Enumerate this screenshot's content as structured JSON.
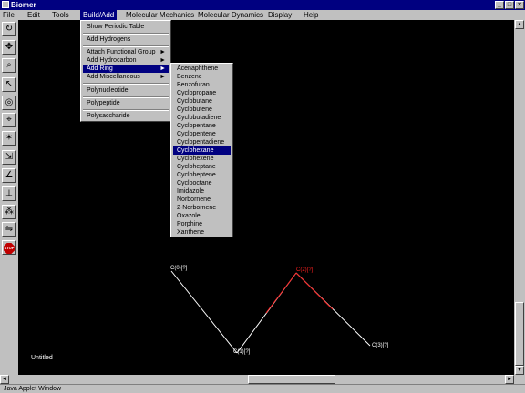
{
  "window": {
    "title": "Biomer"
  },
  "window_buttons": {
    "minimize": "_",
    "maximize": "□",
    "close": "×"
  },
  "menubar": [
    "File",
    "Edit",
    "Tools",
    "Build/Add",
    "Molecular Mechanics",
    "Molecular Dynamics",
    "Display",
    "Help"
  ],
  "active_menu": "Build/Add",
  "build_menu": {
    "show_periodic_table": "Show Periodic Table",
    "add_hydrogens": "Add Hydrogens",
    "attach_functional_group": "Attach Functional Group",
    "add_hydrocarbon": "Add Hydrocarbon",
    "add_ring": "Add Ring",
    "add_miscellaneous": "Add Miscellaneous",
    "polynucleotide": "Polynucleotide",
    "polypeptide": "Polypeptide",
    "polysaccharide": "Polysaccharide",
    "arrow": "►"
  },
  "ring_submenu": [
    "Acenaphthene",
    "Benzene",
    "Benzofuran",
    "Cyclopropane",
    "Cyclobutane",
    "Cyclobutene",
    "Cyclobutadiene",
    "Cyclopentane",
    "Cyclopentene",
    "Cyclopentadiene",
    "Cyclohexane",
    "Cyclohexene",
    "Cycloheptane",
    "Cycloheptene",
    "Cyclooctane",
    "Imidazole",
    "Norbornene",
    "2-Norbornene",
    "Oxazole",
    "Porphine",
    "Xanthene"
  ],
  "selected_ring": "Cyclohexane",
  "toolbar_icons": [
    "rotate-icon",
    "translate-icon",
    "zoom-icon",
    "select-arrow-icon",
    "lasso-icon",
    "select-atom-icon",
    "select-molecule-icon",
    "bond-length-icon",
    "bond-angle-icon",
    "dihedral-icon",
    "add-atom-icon",
    "add-bond-icon",
    "stop-icon"
  ],
  "toolbar_glyphs": [
    "↻",
    "✥",
    "⌕",
    "↖",
    "◎",
    "⌖",
    "✶",
    "⇲",
    "∠",
    "⟂",
    "⁂",
    "⇋",
    "STOP"
  ],
  "molecule": {
    "atoms": [
      {
        "label": "C(0)[?]",
        "color": "#ffffff"
      },
      {
        "label": "C(1)[?]",
        "color": "#ffffff"
      },
      {
        "label": "C(2)[?]",
        "color": "#ff2020"
      },
      {
        "label": "C(3)[?]",
        "color": "#ffffff"
      }
    ],
    "bond_colors": {
      "normal": "#ffffff",
      "selected": "#ff2020"
    }
  },
  "canvas_label": "Untitled",
  "scroll_arrows": {
    "up": "▲",
    "down": "▼",
    "left": "◄",
    "right": "►"
  },
  "status": "Java Applet Window"
}
